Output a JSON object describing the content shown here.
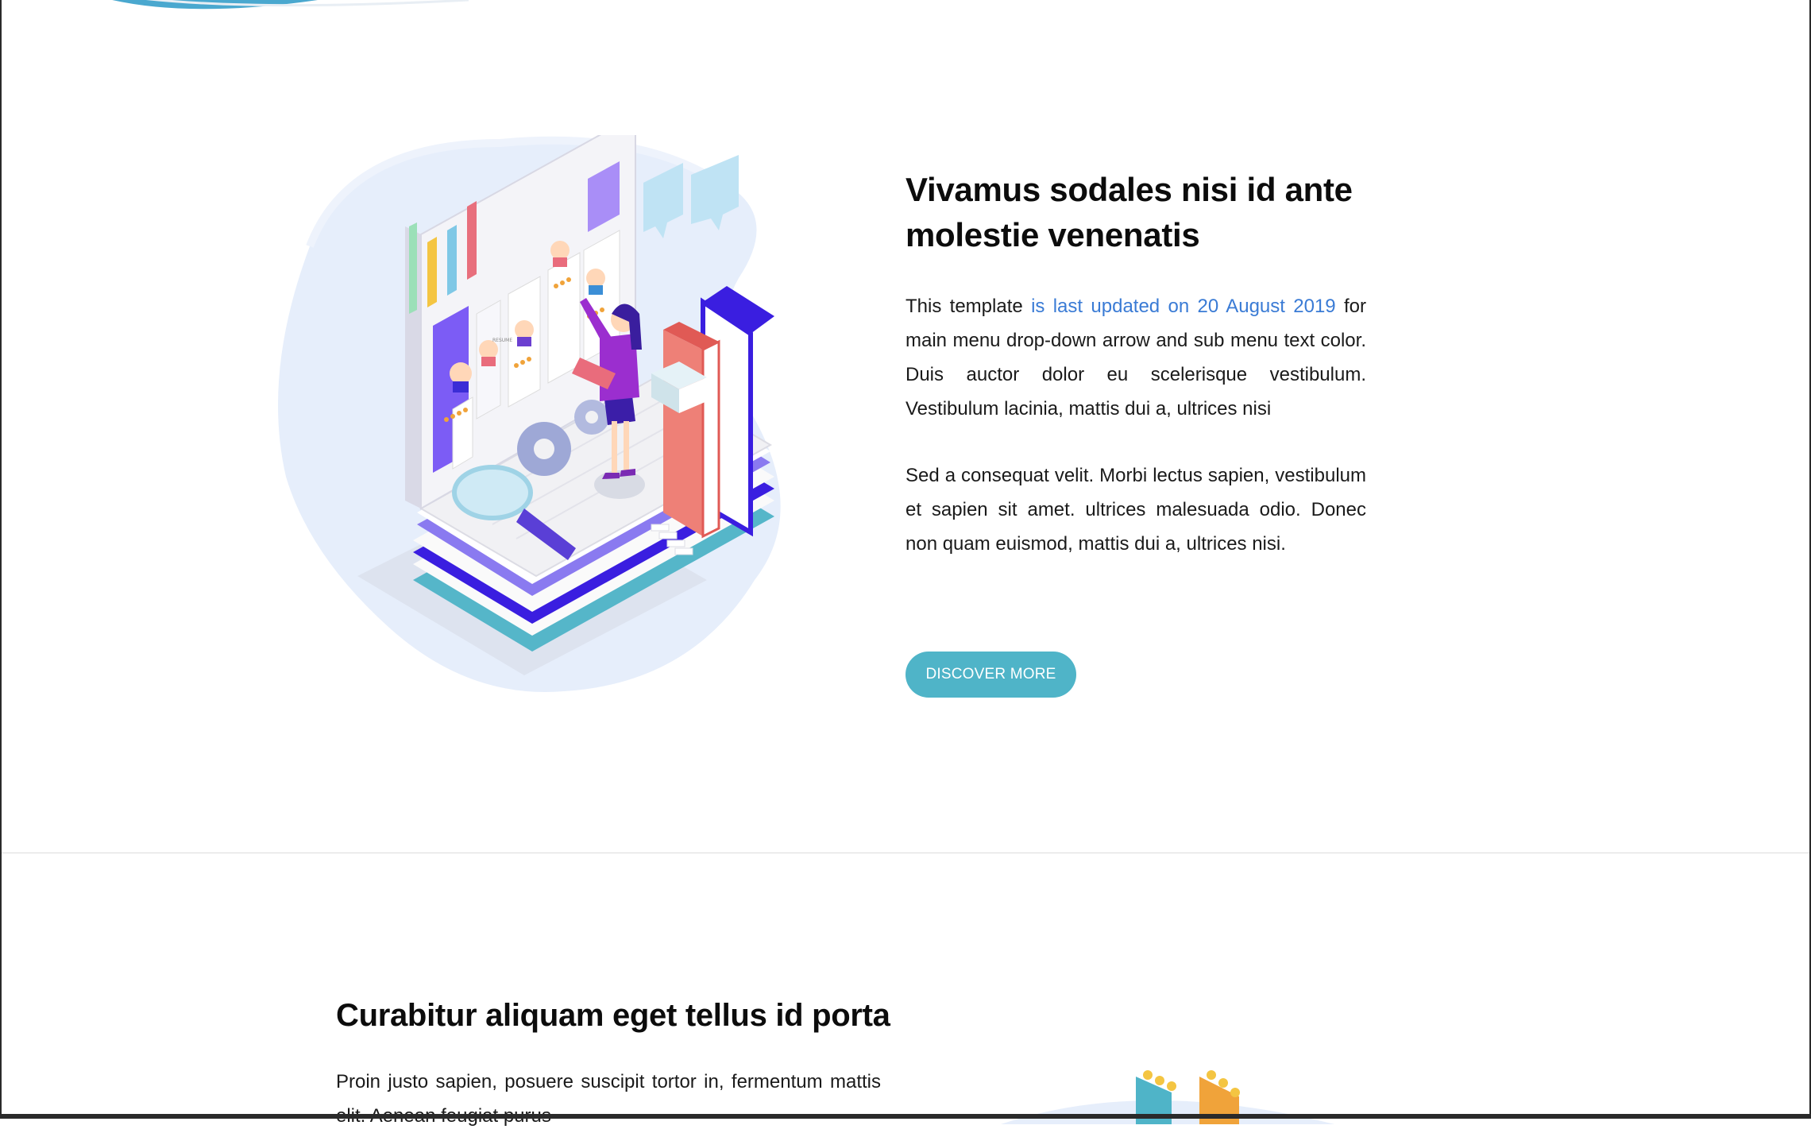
{
  "feature1": {
    "title": "Vivamus sodales nisi id ante molestie venenatis",
    "p1_before": "This template ",
    "p1_link": "is last updated on 20 August 2019",
    "p1_after": " for main menu drop-down arrow and sub menu text color. Duis auctor dolor eu scelerisque vestibulum. Vestibulum lacinia, mattis dui a, ultrices nisi",
    "p2": "Sed a consequat velit. Morbi lectus sapien, vestibulum et sapien sit amet. ultrices malesuada odio. Donec non quam euismod, mattis dui a, ultrices nisi.",
    "button_label": "DISCOVER MORE"
  },
  "feature2": {
    "title": "Curabitur aliquam eget tellus id porta",
    "p1": "Proin justo sapien, posuere suscipit tortor in, fermentum mattis elit. Aenean feugiat purus"
  },
  "illustration": {
    "resume_label": "RESUME"
  },
  "colors": {
    "button": "#4fb4c8",
    "link_accent": "#3a7bd5",
    "top_swoosh": "#4aa8cf"
  }
}
